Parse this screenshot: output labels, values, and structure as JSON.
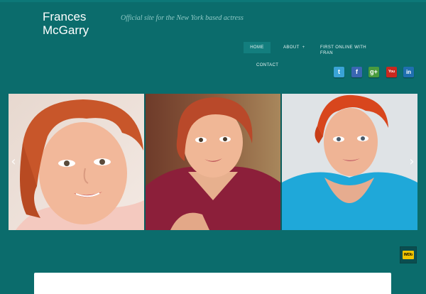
{
  "site": {
    "title": "Frances McGarry",
    "tagline": "Official site for the New York based actress"
  },
  "nav": {
    "items": [
      {
        "label": "HOME",
        "active": true
      },
      {
        "label": "ABOUT",
        "has_submenu": true,
        "caret": "+"
      },
      {
        "label": "FIRST ONLINE WITH FRAN"
      },
      {
        "label": "CONTACT"
      }
    ]
  },
  "social": [
    {
      "name": "twitter-icon",
      "glyph": "t",
      "color": "#3aa3d6"
    },
    {
      "name": "facebook-icon",
      "glyph": "f",
      "color": "#3a66b2"
    },
    {
      "name": "google-plus-icon",
      "glyph": "g+",
      "color": "#4a9b3e"
    },
    {
      "name": "youtube-icon",
      "glyph": "You",
      "color": "#c9281f"
    },
    {
      "name": "linkedin-icon",
      "glyph": "in",
      "color": "#1f6fb0"
    }
  ],
  "slider": {
    "prev_glyph": "‹",
    "next_glyph": "›"
  },
  "imdb": {
    "label": "IMDb"
  },
  "colors": {
    "background": "#0b6c6c",
    "nav_active": "#137e7e",
    "tagline": "#8fc9c6"
  }
}
